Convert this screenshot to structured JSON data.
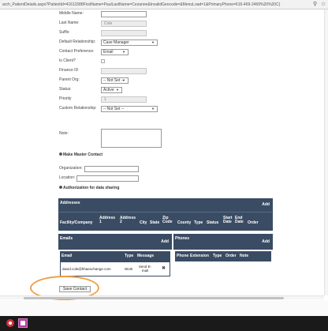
{
  "browser": {
    "url": "arch_PatientDetails.aspx?PatientId=41611588FirstName=PaulLastName=Cezanne&InvalidGeocode=&MenuLoad=1&PrimaryPhone=616-469-2469%20%20C)"
  },
  "form": {
    "middle_name_label": "Middle Name:",
    "last_name_label": "Last Name:",
    "last_name_value": "Cole",
    "suffix_label": "Suffix:",
    "default_relationship_label": "Default Relationship:",
    "default_relationship_value": "Case Manager",
    "contact_pref_label": "Contact Preference:",
    "contact_pref_value": "Email",
    "is_client_label": "Is Client?",
    "finance_id_label": "Finance ID",
    "parent_org_label": "Parent Org:",
    "parent_org_value": "-- Not Set --",
    "status_label": "Status:",
    "status_value": "Active",
    "priority_label": "Priority",
    "priority_value": "1",
    "custom_rel_label": "Custom Relationship:",
    "custom_rel_value": "-- Not Set --",
    "note_label": "Note:",
    "make_master_label": "Make Master Contact",
    "organization_label": "Organization:",
    "location_label": "Location:",
    "auth_label": "Authorization for data sharing"
  },
  "addresses": {
    "title": "Addresses",
    "add_label": "Add",
    "columns": [
      "Facility/Company",
      "Address 1",
      "Address 2",
      "City",
      "State",
      "Zip Code",
      "County",
      "Type",
      "Status",
      "Start Date",
      "End Date",
      "Order"
    ]
  },
  "emails": {
    "title": "Emails",
    "add_label": "Add",
    "columns": [
      "Email",
      "Type",
      "Message"
    ],
    "row": {
      "email": "david.cole@hhaexchange.com",
      "type": "Work",
      "message": "Send E-mail",
      "delete": "✖"
    }
  },
  "phones": {
    "title": "Phones",
    "add_label": "Add",
    "columns": [
      "Phone",
      "Extension",
      "Type",
      "Order",
      "Note"
    ]
  },
  "actions": {
    "save_label": "Save Contact"
  },
  "annotation": {
    "color": "#f0a048"
  }
}
